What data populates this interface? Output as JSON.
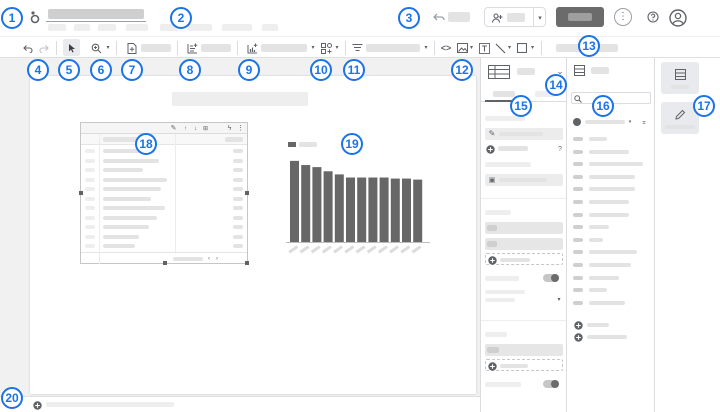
{
  "app": {
    "logo_icon": "looker-studio-logo-icon",
    "icons": {
      "undo_history": "undo-icon",
      "add_user": "person-add-icon",
      "more": "more-vert-icon",
      "help": "help-icon",
      "account": "account-circle-icon"
    }
  },
  "toolbar": {
    "icons": [
      "undo-icon",
      "redo-icon",
      "select-pointer-icon",
      "zoom-icon",
      "add-page-icon",
      "add-data-icon",
      "add-chart-icon",
      "add-control-icon",
      "filter-icon",
      "code-embed-icon",
      "image-icon",
      "text-box-icon",
      "line-icon",
      "shape-icon"
    ]
  },
  "chart_data": {
    "type": "bar",
    "categories": [
      "1",
      "2",
      "3",
      "4",
      "5",
      "6",
      "7",
      "8",
      "9",
      "10",
      "11",
      "12"
    ],
    "values": [
      78,
      74,
      72,
      68,
      65,
      62,
      62,
      62,
      62,
      61,
      61,
      60
    ],
    "ylim": [
      0,
      100
    ]
  },
  "table_widget": {
    "toolbar_icons": [
      "edit-icon",
      "sort-up-icon",
      "sort-down-icon",
      "export-icon",
      "lightning-icon",
      "more-vert-icon"
    ]
  },
  "data_panel": {
    "field_types": [
      "ABC",
      "ABC",
      "123",
      "123",
      "123",
      "123",
      "calendar",
      "ABC",
      "ABC",
      "123",
      "ABC",
      "123",
      "ABC",
      "123"
    ]
  },
  "annotations": [
    "1",
    "2",
    "3",
    "4",
    "5",
    "6",
    "7",
    "8",
    "9",
    "10",
    "11",
    "12",
    "13",
    "14",
    "15",
    "16",
    "17",
    "18",
    "19",
    "20"
  ]
}
